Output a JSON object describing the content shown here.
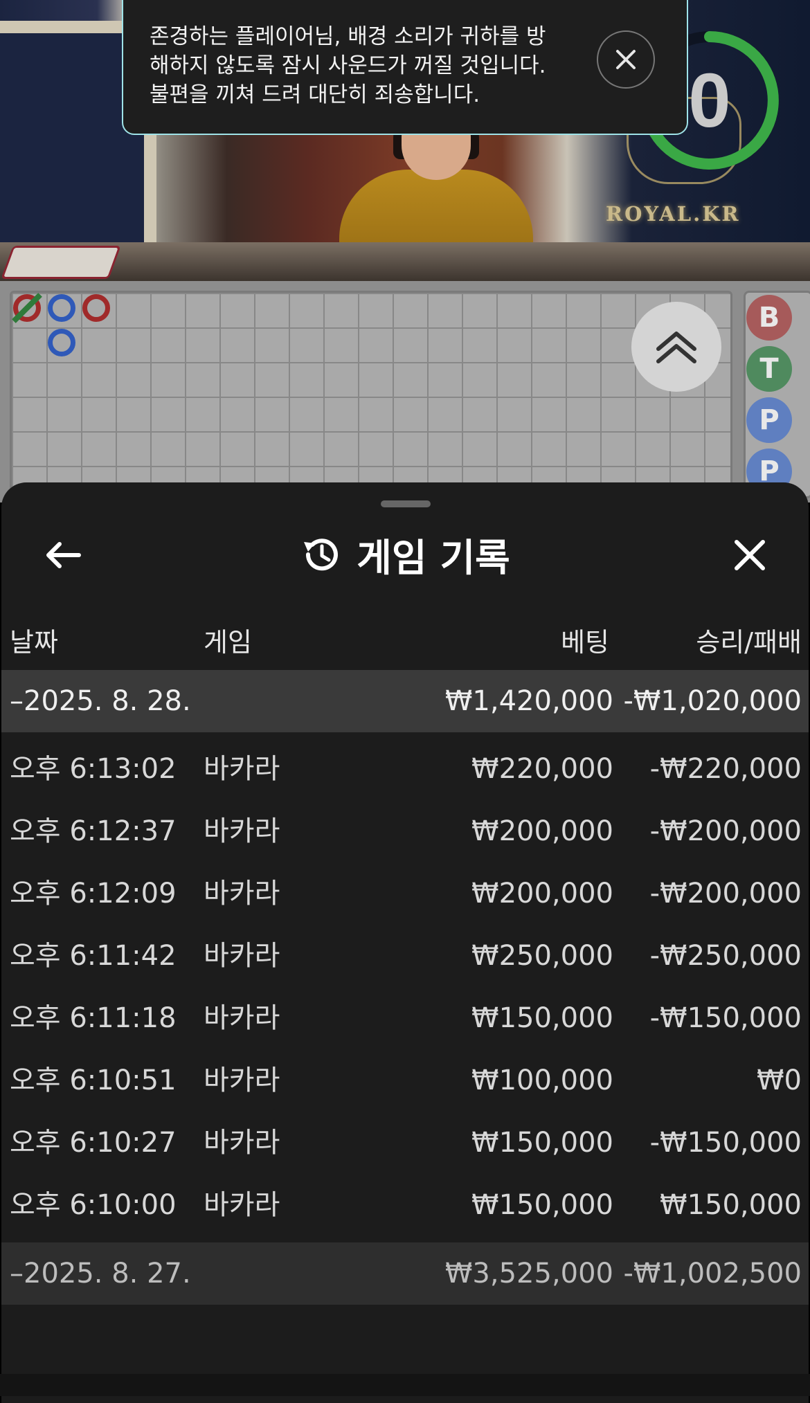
{
  "toast": {
    "message": "존경하는 플레이어님, 배경 소리가 귀하를 방해하지 않도록 잠시 사운드가 꺼질 것입니다. 불편을 끼쳐 드려 대단히 죄송합니다.",
    "close_icon": "close-icon"
  },
  "video": {
    "timer_value": "0",
    "logo_text": "ROYAL.KR",
    "timer_color": "#3aa845"
  },
  "roadmap": {
    "predictions": [
      "B",
      "T",
      "P",
      "P"
    ],
    "expand_icon": "double-chevron-up-icon"
  },
  "history": {
    "title": "게임 기록",
    "title_icon": "history-icon",
    "back_icon": "arrow-left-icon",
    "close_icon": "close-icon",
    "columns": {
      "date": "날짜",
      "game": "게임",
      "bet": "베팅",
      "win_loss": "승리/패배"
    },
    "groups": [
      {
        "date": "–2025. 8. 28.",
        "bet": "₩1,420,000",
        "win_loss": "-₩1,020,000",
        "rows": [
          {
            "time": "오후 6:13:02",
            "game": "바카라",
            "bet": "₩220,000",
            "win_loss": "-₩220,000"
          },
          {
            "time": "오후 6:12:37",
            "game": "바카라",
            "bet": "₩200,000",
            "win_loss": "-₩200,000"
          },
          {
            "time": "오후 6:12:09",
            "game": "바카라",
            "bet": "₩200,000",
            "win_loss": "-₩200,000"
          },
          {
            "time": "오후 6:11:42",
            "game": "바카라",
            "bet": "₩250,000",
            "win_loss": "-₩250,000"
          },
          {
            "time": "오후 6:11:18",
            "game": "바카라",
            "bet": "₩150,000",
            "win_loss": "-₩150,000"
          },
          {
            "time": "오후 6:10:51",
            "game": "바카라",
            "bet": "₩100,000",
            "win_loss": "₩0"
          },
          {
            "time": "오후 6:10:27",
            "game": "바카라",
            "bet": "₩150,000",
            "win_loss": "-₩150,000"
          },
          {
            "time": "오후 6:10:00",
            "game": "바카라",
            "bet": "₩150,000",
            "win_loss": "₩150,000"
          }
        ]
      },
      {
        "date": "–2025. 8. 27.",
        "bet": "₩3,525,000",
        "win_loss": "-₩1,002,500",
        "rows": []
      }
    ]
  }
}
